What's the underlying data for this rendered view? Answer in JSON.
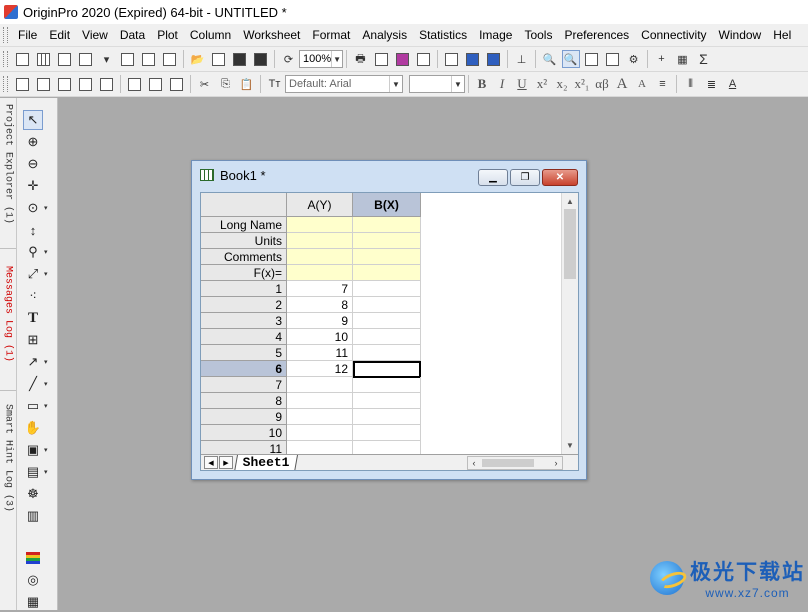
{
  "app": {
    "title": "OriginPro 2020 (Expired) 64-bit - UNTITLED *"
  },
  "menu": [
    "File",
    "Edit",
    "View",
    "Data",
    "Plot",
    "Column",
    "Worksheet",
    "Format",
    "Analysis",
    "Statistics",
    "Image",
    "Tools",
    "Preferences",
    "Connectivity",
    "Window",
    "Hel"
  ],
  "toolbar": {
    "zoom_value": "100%",
    "font_name": "Default: Arial",
    "font_size": "",
    "bold_label": "B",
    "italic_label": "I",
    "underline_label": "U",
    "superscript_label": "x²",
    "subscript_label": "x₂",
    "sub_super_label": "x²₁",
    "greek_label": "αβ",
    "increase_font_label": "A",
    "decrease_font_label": "A",
    "sum_label": "Σ"
  },
  "side_panels": {
    "project_explorer": "Project Explorer (1)",
    "messages_log": "Messages Log (1)",
    "smart_hint_log": "Smart Hint Log (3)"
  },
  "book": {
    "title": "Book1 *",
    "columns": [
      {
        "label": "A(Y)",
        "selected": false
      },
      {
        "label": "B(X)",
        "selected": true
      }
    ],
    "meta_rows": [
      "Long Name",
      "Units",
      "Comments",
      "F(x)="
    ],
    "rows": [
      {
        "n": "1",
        "a": "7",
        "b": ""
      },
      {
        "n": "2",
        "a": "8",
        "b": ""
      },
      {
        "n": "3",
        "a": "9",
        "b": ""
      },
      {
        "n": "4",
        "a": "10",
        "b": ""
      },
      {
        "n": "5",
        "a": "11",
        "b": ""
      },
      {
        "n": "6",
        "a": "12",
        "b": "",
        "selected": true
      },
      {
        "n": "7",
        "a": "",
        "b": ""
      },
      {
        "n": "8",
        "a": "",
        "b": ""
      },
      {
        "n": "9",
        "a": "",
        "b": ""
      },
      {
        "n": "10",
        "a": "",
        "b": ""
      },
      {
        "n": "11",
        "a": "",
        "b": ""
      }
    ],
    "sheet_tab": "Sheet1"
  },
  "watermark": {
    "cn": "极光下载站",
    "url": "www.xz7.com"
  },
  "colors": {
    "meta_fill": "#ffffcc",
    "selected_header": "#b9c4d8",
    "window_frame": "#cfe0f3",
    "workspace": "#aaaaaa"
  }
}
